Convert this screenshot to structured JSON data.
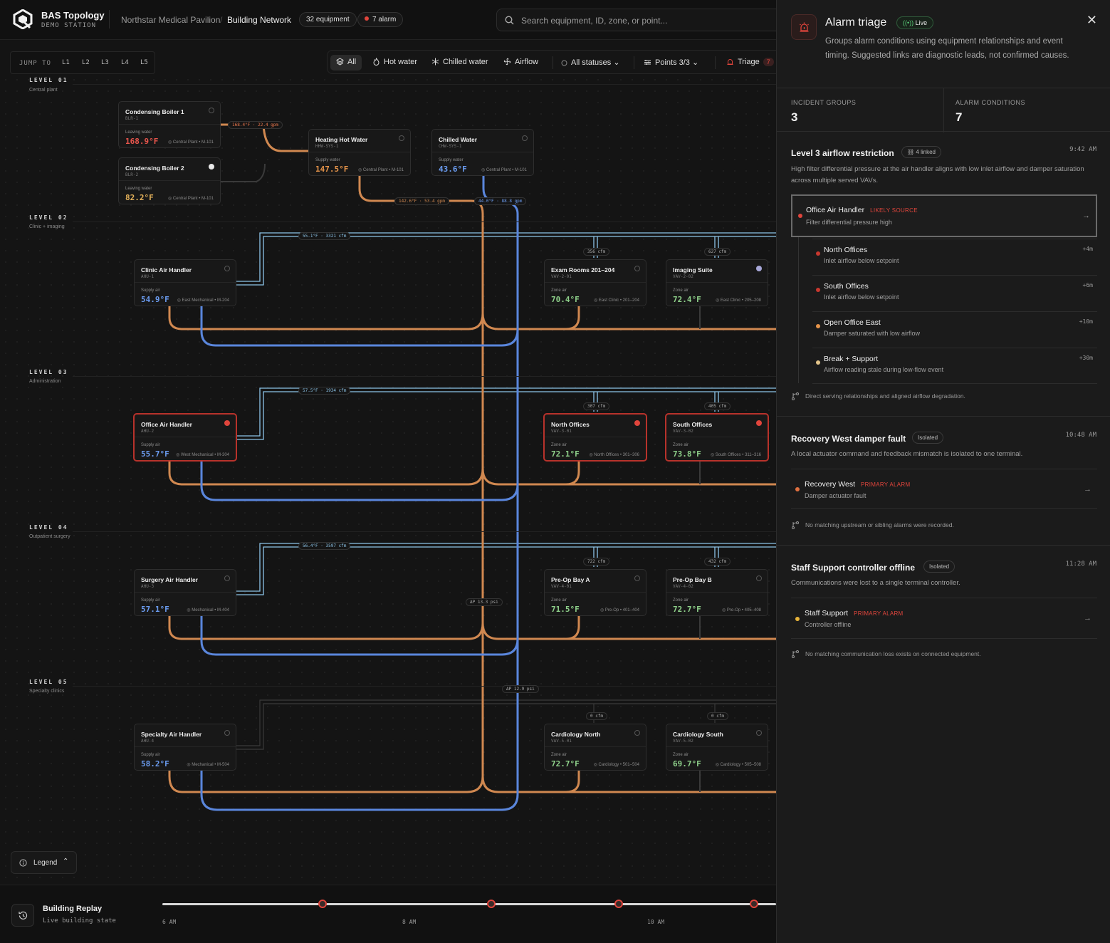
{
  "brand": {
    "title": "BAS Topology",
    "subtitle": "DEMO STATION"
  },
  "breadcrumb": {
    "site": "Northstar Medical Pavilion",
    "separator": "/",
    "view": "Building Network"
  },
  "header_pills": {
    "equipment": "32 equipment",
    "alarms": "7 alarm"
  },
  "search": {
    "placeholder": "Search equipment, ID, zone, or point..."
  },
  "jump": {
    "label": "JUMP TO",
    "levels": [
      "L1",
      "L2",
      "L3",
      "L4",
      "L5"
    ]
  },
  "toolbar": {
    "all": "All",
    "hot_water": "Hot water",
    "chilled_water": "Chilled water",
    "airflow": "Airflow",
    "statuses": "All statuses",
    "points": "Points 3/3",
    "triage": "Triage",
    "triage_count": "7"
  },
  "levels": [
    {
      "title": "LEVEL 01",
      "subtitle": "Central plant"
    },
    {
      "title": "LEVEL 02",
      "subtitle": "Clinic + imaging"
    },
    {
      "title": "LEVEL 03",
      "subtitle": "Administration"
    },
    {
      "title": "LEVEL 04",
      "subtitle": "Outpatient surgery"
    },
    {
      "title": "LEVEL 05",
      "subtitle": "Specialty clinics"
    }
  ],
  "equipment": [
    {
      "name": "Condensing Boiler 1",
      "id": "BLR-1",
      "label": "Leaving water",
      "value": "168.9°F",
      "location": "Central Plant • M-101",
      "status": "gear"
    },
    {
      "name": "Condensing Boiler 2",
      "id": "BLR-2",
      "label": "Leaving water",
      "value": "82.2°F",
      "location": "Central Plant • M-101",
      "status": "white"
    },
    {
      "name": "Heating Hot Water",
      "id": "HHW-SYS-1",
      "label": "Supply water",
      "value": "147.5°F",
      "location": "Central Plant • M-101",
      "status": "gear"
    },
    {
      "name": "Chilled Water",
      "id": "CHW-SYS-1",
      "label": "Supply water",
      "value": "43.6°F",
      "location": "Central Plant • M-101",
      "status": "gear"
    },
    {
      "name": "Clinic Air Handler",
      "id": "AHU-1",
      "label": "Supply air",
      "value": "54.9°F",
      "location": "East Mechanical • M-204",
      "status": "gear"
    },
    {
      "name": "Exam Rooms 201–204",
      "id": "VAV-2-01",
      "label": "Zone air",
      "value": "70.4°F",
      "location": "East Clinic • 201–204",
      "status": "gear"
    },
    {
      "name": "Imaging Suite",
      "id": "VAV-2-02",
      "label": "Zone air",
      "value": "72.4°F",
      "location": "East Clinic • 205–208",
      "status": "lav"
    },
    {
      "name": "Office Air Handler",
      "id": "AHU-2",
      "label": "Supply air",
      "value": "55.7°F",
      "location": "West Mechanical • M-304",
      "status": "red"
    },
    {
      "name": "North Offices",
      "id": "VAV-3-01",
      "label": "Zone air",
      "value": "72.1°F",
      "location": "North Offices • 301–306",
      "status": "red"
    },
    {
      "name": "South Offices",
      "id": "VAV-3-02",
      "label": "Zone air",
      "value": "73.8°F",
      "location": "South Offices • 311–316",
      "status": "red"
    },
    {
      "name": "Surgery Air Handler",
      "id": "AHU-3",
      "label": "Supply air",
      "value": "57.1°F",
      "location": "Mechanical • M-404",
      "status": "gear"
    },
    {
      "name": "Pre-Op Bay A",
      "id": "VAV-4-01",
      "label": "Zone air",
      "value": "71.5°F",
      "location": "Pre-Op • 401–404",
      "status": "gear"
    },
    {
      "name": "Pre-Op Bay B",
      "id": "VAV-4-02",
      "label": "Zone air",
      "value": "72.7°F",
      "location": "Pre-Op • 405–408",
      "status": "gear"
    },
    {
      "name": "Specialty Air Handler",
      "id": "AHU-4",
      "label": "Supply air",
      "value": "58.2°F",
      "location": "Mechanical • M-504",
      "status": "gear"
    },
    {
      "name": "Cardiology North",
      "id": "VAV-5-01",
      "label": "Zone air",
      "value": "72.7°F",
      "location": "Cardiology • 501–504",
      "status": "gear"
    },
    {
      "name": "Cardiology South",
      "id": "VAV-5-02",
      "label": "Zone air",
      "value": "69.7°F",
      "location": "Cardiology • 505–508",
      "status": "gear"
    }
  ],
  "flow_tags": {
    "boiler": "168.4°F · 22.4 gpm",
    "hhw": "142.6°F · 53.4 gpm",
    "chw": "44.0°F · 88.8 gpm",
    "l2_air": "55.1°F · 3321 cfm",
    "l2_exam": "356 cfm",
    "l2_img": "627 cfm",
    "l3_air": "57.5°F · 1934 cfm",
    "l3_north": "307 cfm",
    "l3_south": "405 cfm",
    "l4_air": "56.4°F · 3597 cfm",
    "l4_a": "722 cfm",
    "l4_b": "432 cfm",
    "hhw_dp": "ΔP 13.3 psi",
    "chw_dp": "ΔP 12.9 psi",
    "l5_n": "0 cfm",
    "l5_s": "0 cfm"
  },
  "legend": {
    "label": "Legend"
  },
  "replay": {
    "title": "Building Replay",
    "subtitle": "Live building state",
    "ticks": [
      "6 AM",
      "8 AM",
      "10 AM"
    ]
  },
  "panel": {
    "title": "Alarm triage",
    "live": "Live",
    "description": "Groups alarm conditions using equipment relationships and event timing. Suggested links are diagnostic leads, not confirmed causes.",
    "stats": {
      "groups_label": "INCIDENT GROUPS",
      "groups_value": "3",
      "conditions_label": "ALARM CONDITIONS",
      "conditions_value": "7"
    },
    "groups": [
      {
        "title": "Level 3 airflow restriction",
        "badge": "4 linked",
        "time": "9:42 AM",
        "description": "High filter differential pressure at the air handler aligns with low inlet airflow and damper saturation across multiple served VAVs.",
        "source": {
          "name": "Office Air Handler",
          "tag": "LIKELY SOURCE",
          "desc": "Filter differential pressure high",
          "color": "#e0453c"
        },
        "linked": [
          {
            "name": "North Offices",
            "desc": "Inlet airflow below setpoint",
            "time": "+4m",
            "color": "#c8382f"
          },
          {
            "name": "South Offices",
            "desc": "Inlet airflow below setpoint",
            "time": "+6m",
            "color": "#c8382f"
          },
          {
            "name": "Open Office East",
            "desc": "Damper saturated with low airflow",
            "time": "+10m",
            "color": "#e6944a"
          },
          {
            "name": "Break + Support",
            "desc": "Airflow reading stale during low-flow event",
            "time": "+30m",
            "color": "#e3c58a"
          }
        ],
        "note": "Direct serving relationships and aligned airflow degradation."
      },
      {
        "title": "Recovery West damper fault",
        "badge": "Isolated",
        "time": "10:48 AM",
        "description": "A local actuator command and feedback mismatch is isolated to one terminal.",
        "source": {
          "name": "Recovery West",
          "tag": "PRIMARY ALARM",
          "desc": "Damper actuator fault",
          "color": "#e07040"
        },
        "note": "No matching upstream or sibling alarms were recorded."
      },
      {
        "title": "Staff Support controller offline",
        "badge": "Isolated",
        "time": "11:28 AM",
        "description": "Communications were lost to a single terminal controller.",
        "source": {
          "name": "Staff Support",
          "tag": "PRIMARY ALARM",
          "desc": "Controller offline",
          "color": "#e8b43a"
        },
        "note": "No matching communication loss exists on connected equipment."
      }
    ]
  }
}
